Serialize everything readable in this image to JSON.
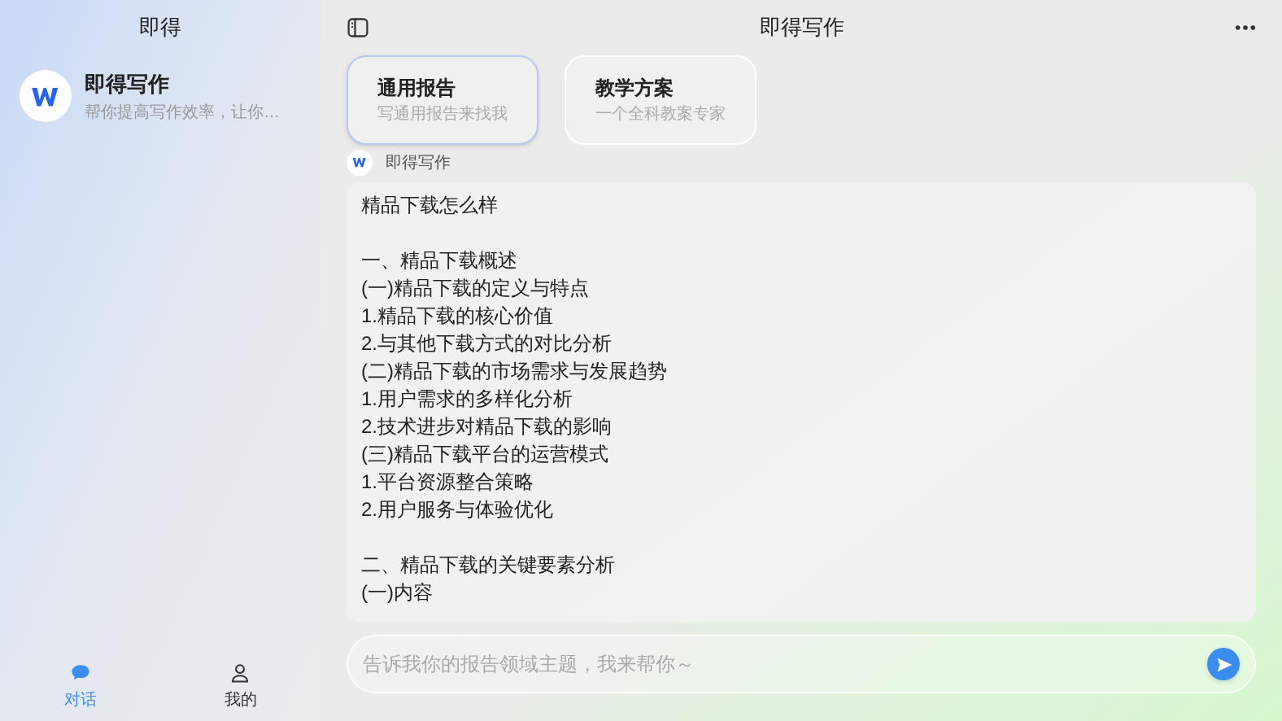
{
  "sidebar": {
    "title": "即得",
    "chats": [
      {
        "name": "即得写作",
        "preview": "帮你提高写作效率，让你…",
        "selected": true
      }
    ],
    "nav": [
      {
        "label": "对话",
        "selected": true,
        "kind": "chat"
      },
      {
        "label": "我的",
        "selected": false,
        "kind": "profile"
      }
    ]
  },
  "header": {
    "title": "即得写作"
  },
  "cards": [
    {
      "title": "通用报告",
      "subtitle": "写通用报告来找我",
      "selected": true
    },
    {
      "title": "教学方案",
      "subtitle": "一个全科教案专家",
      "selected": false
    }
  ],
  "message": {
    "sender": "即得写作",
    "paragraphs": [
      [
        "精品下载怎么样"
      ],
      [
        "一、精品下载概述",
        "(一)精品下载的定义与特点",
        "1.精品下载的核心价值",
        "2.与其他下载方式的对比分析",
        "(二)精品下载的市场需求与发展趋势",
        "1.用户需求的多样化分析",
        "2.技术进步对精品下载的影响",
        "(三)精品下载平台的运营模式",
        "1.平台资源整合策略",
        "2.用户服务与体验优化"
      ],
      [
        "二、精品下载的关键要素分析",
        "(一)内容"
      ]
    ]
  },
  "input": {
    "placeholder": "告诉我你的报告领域主题，我来帮你～"
  }
}
